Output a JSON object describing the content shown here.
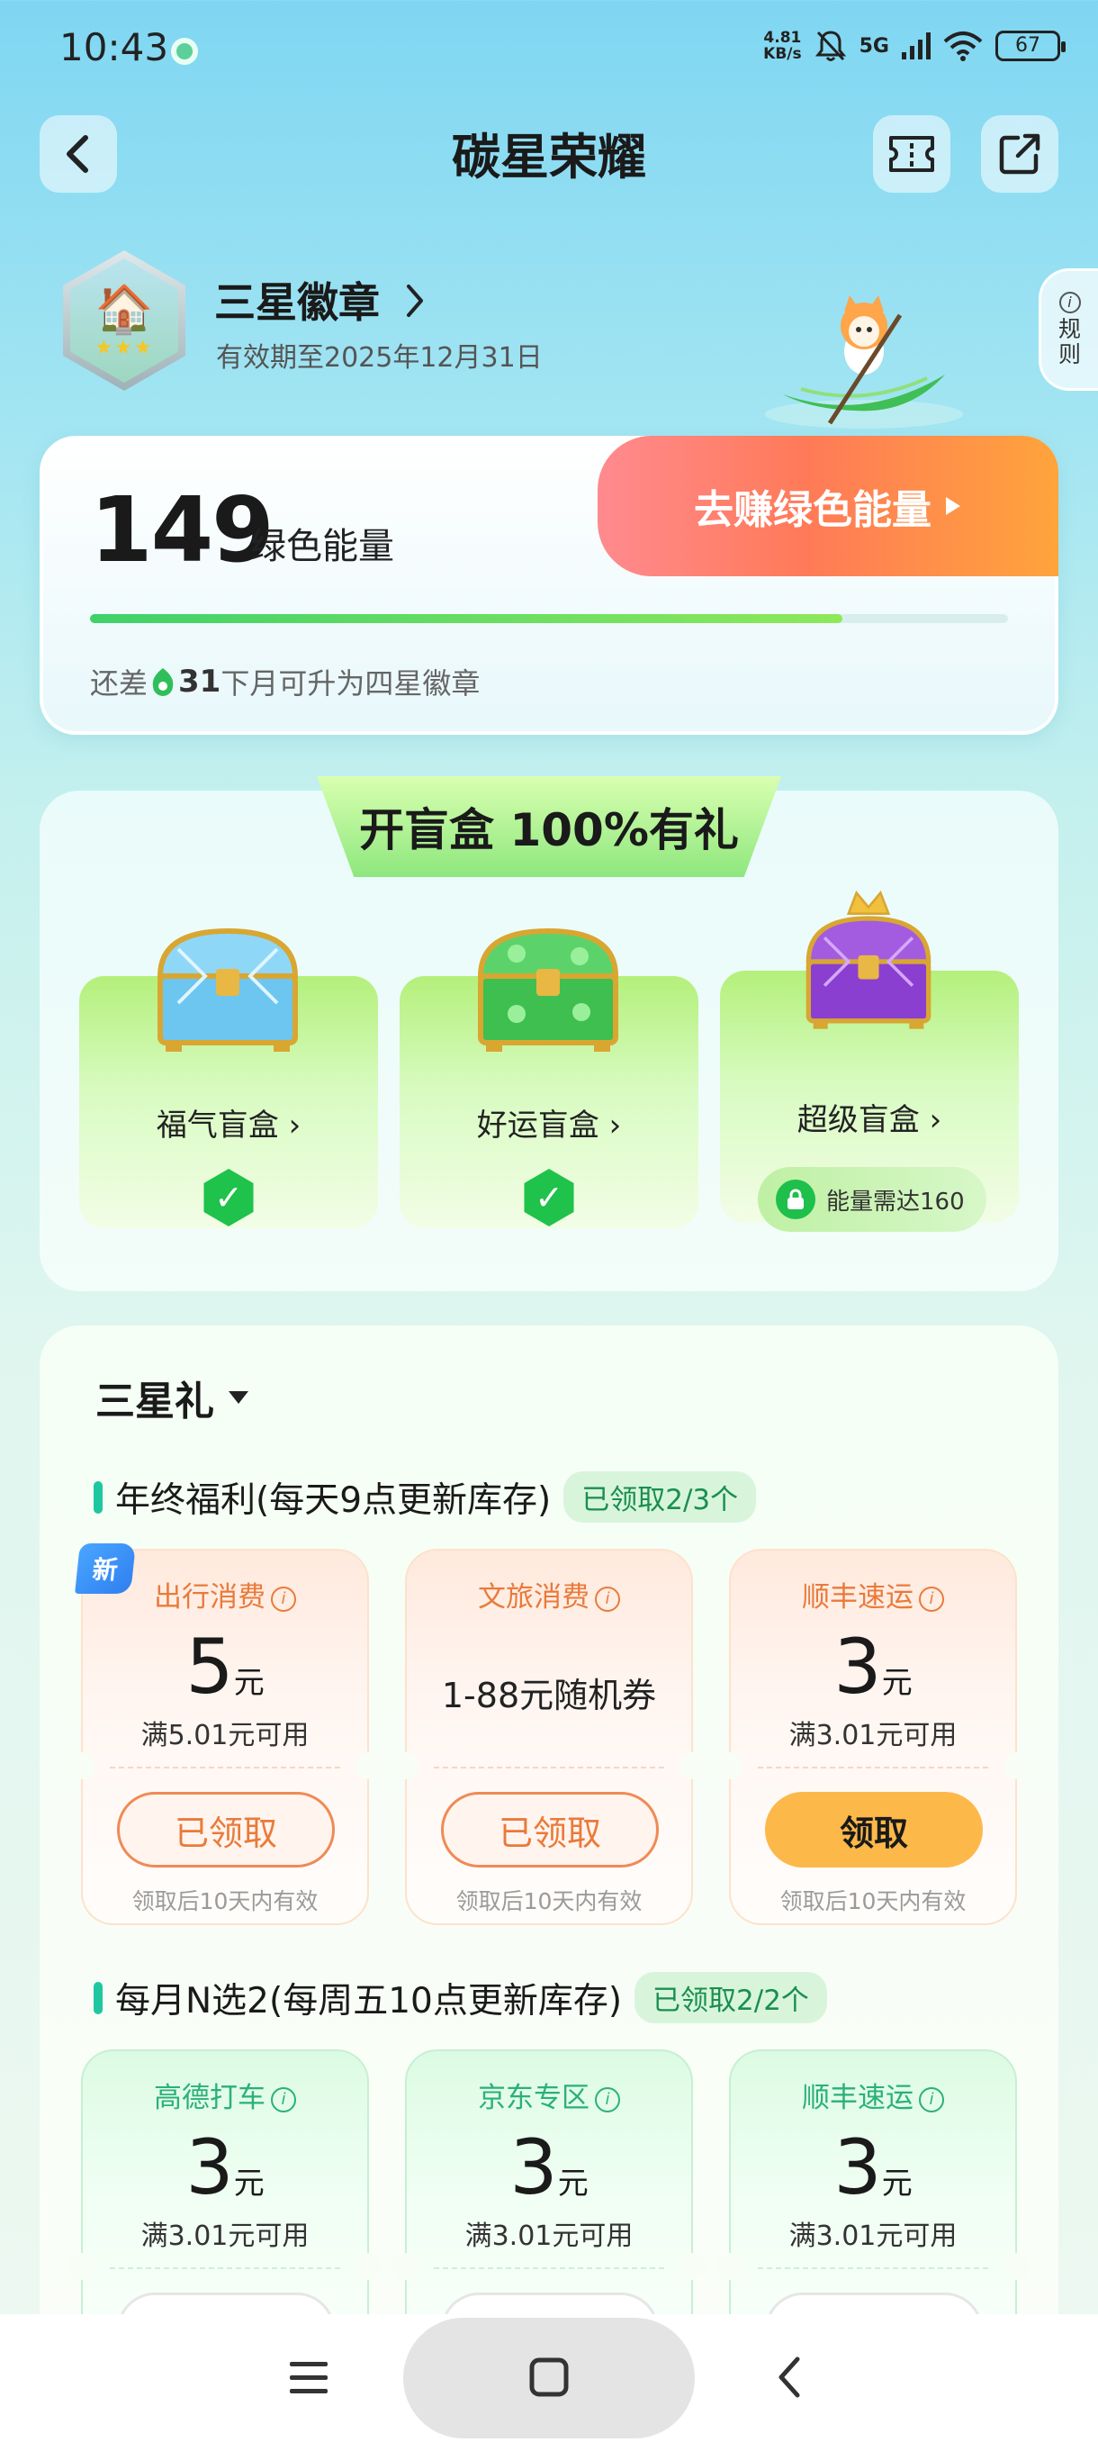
{
  "status_bar": {
    "time": "10:43",
    "net_speed_value": "4.81",
    "net_speed_unit": "KB/s",
    "mute_icon": "bell-off-icon",
    "signal": "5G",
    "battery": "67"
  },
  "header": {
    "title": "碳星荣耀",
    "back_icon": "back-chevron-icon",
    "ticket_icon": "ticket-icon",
    "share_icon": "share-icon"
  },
  "badge": {
    "name": "三星徽章",
    "valid_until": "有效期至2025年12月31日",
    "rules_label_1": "规",
    "rules_label_2": "则"
  },
  "energy": {
    "value": "149",
    "unit": "绿色能量",
    "earn_button": "去赚绿色能量",
    "progress_fraction": 0.82,
    "hint_prefix": "还差",
    "hint_number": "31",
    "hint_suffix": "下月可升为四星徽章"
  },
  "blind_box": {
    "banner": "开盲盒 100%有礼",
    "boxes": [
      {
        "label": "福气盲盒 ›",
        "status": "completed"
      },
      {
        "label": "好运盲盒 ›",
        "status": "completed"
      },
      {
        "label": "超级盲盒 ›",
        "status": "locked",
        "lock_text": "能量需达160"
      }
    ]
  },
  "gifts": {
    "title": "三星礼",
    "sections": [
      {
        "heading": "年终福利(每天9点更新库存)",
        "tag": "已领取2/3个",
        "new_badge": "新",
        "coupons": [
          {
            "name": "出行消费",
            "amount": "5",
            "unit": "元",
            "condition": "满5.01元可用",
            "button": "已领取",
            "validity": "领取后10天内有效"
          },
          {
            "name": "文旅消费",
            "text": "1-88元随机券",
            "button": "已领取",
            "validity": "领取后10天内有效"
          },
          {
            "name": "顺丰速运",
            "amount": "3",
            "unit": "元",
            "condition": "满3.01元可用",
            "button": "领取",
            "validity": "领取后10天内有效"
          }
        ]
      },
      {
        "heading": "每月N选2(每周五10点更新库存)",
        "tag": "已领取2/2个",
        "coupons": [
          {
            "name": "高德打车",
            "amount": "3",
            "unit": "元",
            "condition": "满3.01元可用"
          },
          {
            "name": "京东专区",
            "amount": "3",
            "unit": "元",
            "condition": "满3.01元可用"
          },
          {
            "name": "顺丰速运",
            "amount": "3",
            "unit": "元",
            "condition": "满3.01元可用"
          }
        ]
      }
    ]
  },
  "nav": {
    "menu_icon": "menu-icon",
    "home_icon": "home-square-icon",
    "back_icon": "nav-back-icon"
  },
  "colors": {
    "accent_green": "#1fc24a",
    "earn_gradient_start": "#ff8a8f",
    "earn_gradient_end": "#ffa43c",
    "coupon_orange": "#ea7a3a",
    "coupon_green": "#2bb07a"
  }
}
